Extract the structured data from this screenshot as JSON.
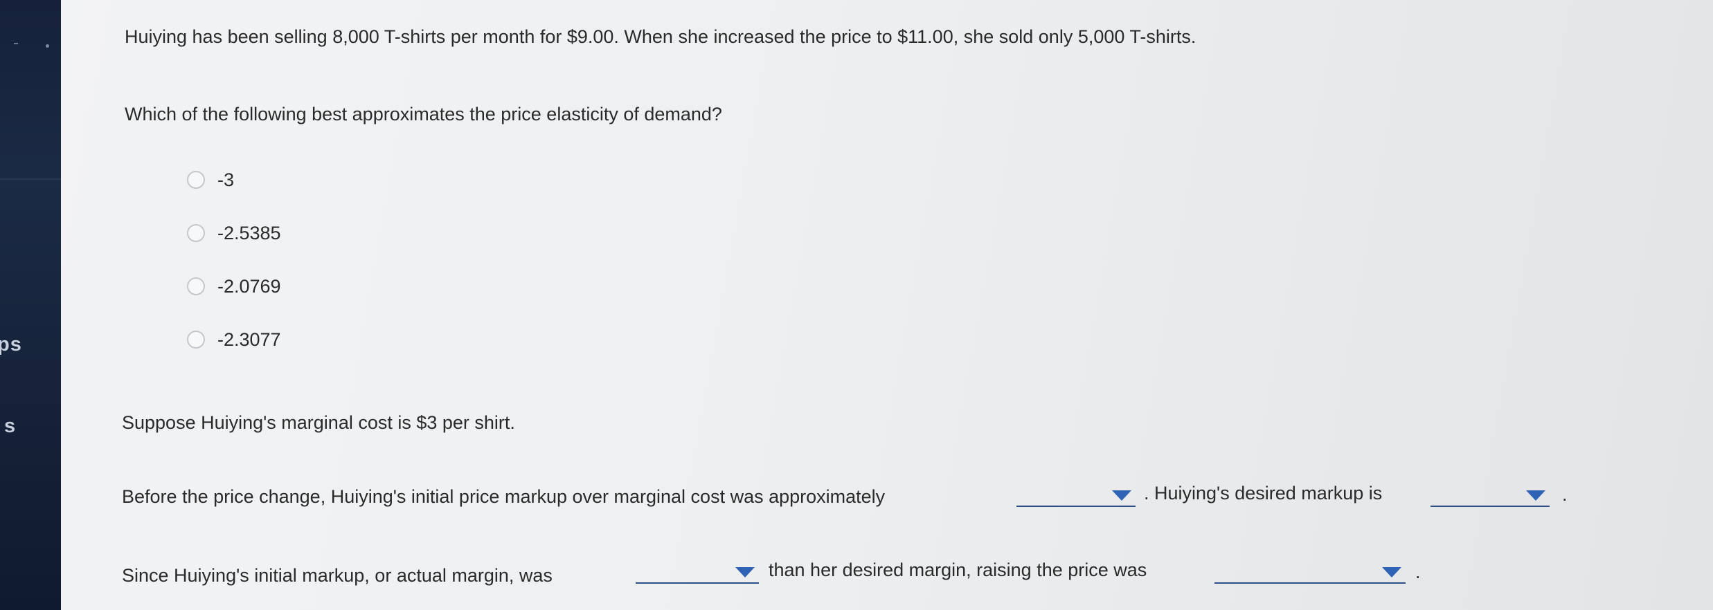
{
  "sidebar": {
    "fragment_1": "ps",
    "fragment_2": "s"
  },
  "question1": {
    "stem": "Huiying has been selling 8,000 T-shirts per month for $9.00. When she increased the price to $11.00, she sold only 5,000 T-shirts.",
    "prompt": "Which of the following best approximates the price elasticity of demand?",
    "options": [
      {
        "label": "-3"
      },
      {
        "label": "-2.5385"
      },
      {
        "label": "-2.0769"
      },
      {
        "label": "-2.3077"
      }
    ]
  },
  "question2": {
    "setup": "Suppose Huiying's marginal cost is $3 per shirt.",
    "sentence1_part1": "Before the price change, Huiying's initial price markup over marginal cost was approximately",
    "sentence1_part2": ". Huiying's desired markup is",
    "sentence1_end": ".",
    "sentence2_part1": "Since Huiying's initial markup, or actual margin, was",
    "sentence2_part2": "than her desired margin, raising the price was",
    "sentence2_end": ".",
    "dropdowns": {
      "initial_markup": "",
      "desired_markup": "",
      "comparison": "",
      "price_raise": ""
    }
  },
  "colors": {
    "sidebar_bg": "#16233b",
    "text": "#2a2a2a",
    "dropdown_accent": "#2f63b5"
  }
}
